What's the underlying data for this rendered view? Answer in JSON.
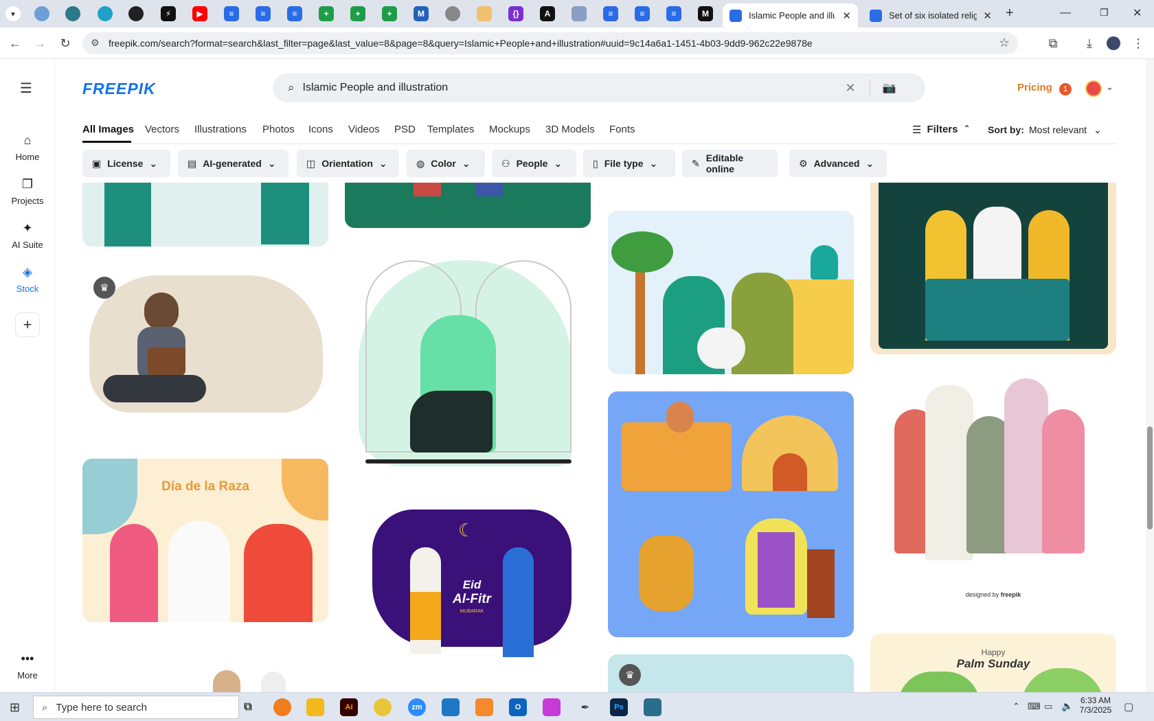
{
  "browser": {
    "tabs": [
      {
        "title": "Islamic People and illustra",
        "active": true
      },
      {
        "title": "Set of six isolated religious",
        "active": false
      }
    ],
    "new_tab": "+",
    "url": "freepik.com/search?format=search&last_filter=page&last_value=8&page=8&query=Islamic+People+and+illustration#uuid=9c14a6a1-1451-4b03-9dd9-962c22e9878e"
  },
  "sidebar": {
    "items": [
      {
        "label": "Home",
        "icon": "home-icon"
      },
      {
        "label": "Projects",
        "icon": "projects-icon"
      },
      {
        "label": "AI Suite",
        "icon": "sparkle-icon"
      },
      {
        "label": "Stock",
        "icon": "stock-icon"
      }
    ],
    "more_label": "More"
  },
  "header": {
    "logo": "FREEPIK",
    "search_value": "Islamic People and illustration",
    "pricing": "Pricing",
    "notification_count": "1"
  },
  "nav_tabs": [
    "All Images",
    "Vectors",
    "Illustrations",
    "Photos",
    "Icons",
    "Videos",
    "PSD",
    "Templates",
    "Mockups",
    "3D Models",
    "Fonts"
  ],
  "filters": {
    "filters_label": "Filters",
    "sort_label": "Sort by:",
    "sort_value": "Most relevant",
    "chips": [
      "License",
      "AI-generated",
      "Orientation",
      "Color",
      "People",
      "File type",
      "Editable online",
      "Advanced"
    ]
  },
  "images": {
    "dia_de_la_raza": "Día de la Raza",
    "eid_title": "Eid",
    "eid_sub": "Al-Fitr",
    "eid_small": "MUBARAK",
    "palm_happy": "Happy",
    "palm_title": "Palm Sunday",
    "designed_by": "designed by",
    "freepik_small": "freepik"
  },
  "taskbar": {
    "search_placeholder": "Type here to search",
    "time": "6:33 AM",
    "date": "7/3/2025"
  }
}
